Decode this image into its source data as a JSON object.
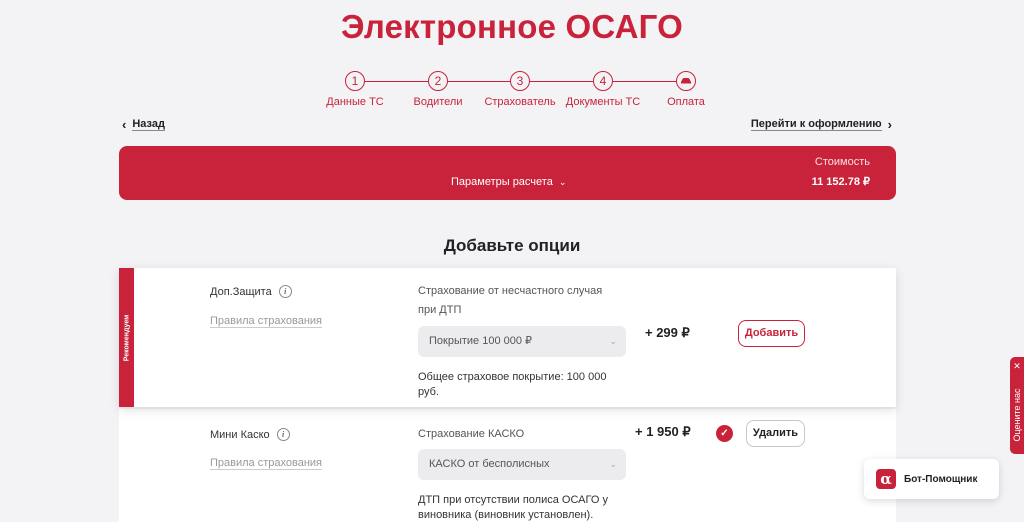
{
  "header": {
    "title": "Электронное ОСАГО"
  },
  "steps": [
    {
      "number": "1",
      "label": "Данные ТС"
    },
    {
      "number": "2",
      "label": "Водители"
    },
    {
      "number": "3",
      "label": "Страхователь"
    },
    {
      "number": "4",
      "label": "Документы ТС"
    },
    {
      "number": "",
      "icon": "car-icon",
      "label": "Оплата"
    }
  ],
  "nav": {
    "back": "Назад",
    "forward": "Перейти к оформлению"
  },
  "calc": {
    "params_label": "Параметры расчета",
    "cost_label": "Стоимость",
    "cost_value": "11 152.78 ₽"
  },
  "section_title": "Добавьте опции",
  "options": [
    {
      "badge": "Рекомендуем",
      "name": "Доп.Защита",
      "rules_link": "Правила страхования",
      "description_line1": "Страхование от несчастного случая",
      "description_line2": "при ДТП",
      "select_value": "Покрытие 100 000 ₽",
      "note_line1": "Общее страховое покрытие: 100 000",
      "note_line2": "руб.",
      "price": "+ 299 ₽",
      "action": "Добавить",
      "selected": false
    },
    {
      "name": "Мини Каско",
      "rules_link": "Правила страхования",
      "description_line1": "Страхование КАСКО",
      "select_value": "КАСКО от бесполисных",
      "note_line1": "ДТП при отсутствии полиса ОСАГО у",
      "note_line2": "виновника (виновник установлен).",
      "price": "+ 1 950 ₽",
      "action": "Удалить",
      "selected": true
    }
  ],
  "rate_tab": {
    "label": "Оцените нас"
  },
  "bot": {
    "label": "Бот-Помощник"
  },
  "colors": {
    "accent": "#c8233b",
    "background": "#f3f3f5"
  }
}
